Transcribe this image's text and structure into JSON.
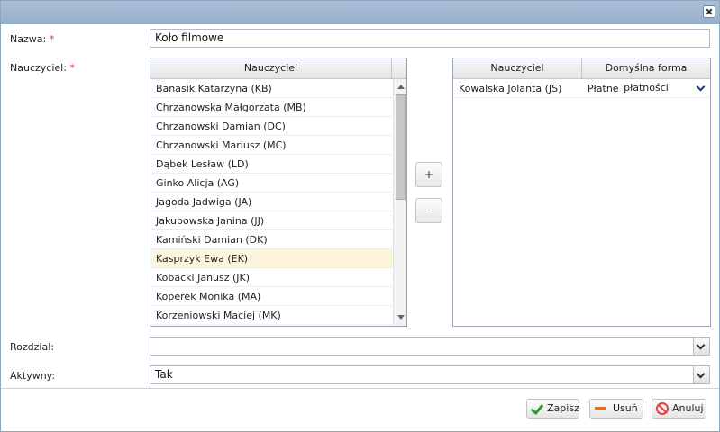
{
  "window": {
    "close_icon": "close-icon"
  },
  "form": {
    "nazwa": {
      "label": "Nazwa:",
      "required": "*",
      "value": "Koło filmowe"
    },
    "nauczyciel": {
      "label": "Nauczyciel:",
      "required": "*"
    },
    "rozdzial": {
      "label": "Rozdział:",
      "value": ""
    },
    "aktywny": {
      "label": "Aktywny:",
      "value": "Tak"
    }
  },
  "available_grid": {
    "header": "Nauczyciel",
    "rows": [
      "Banasik Katarzyna (KB)",
      "Chrzanowska Małgorzata (MB)",
      "Chrzanowski Damian (DC)",
      "Chrzanowski Mariusz (MC)",
      "Dąbek Lesław (LD)",
      "Ginko Alicja (AG)",
      "Jagoda Jadwiga (JA)",
      "Jakubowska Janina (JJ)",
      "Kamiński Damian (DK)",
      "Kasprzyk Ewa (EK)",
      "Kobacki Janusz (JK)",
      "Koperek Monika (MA)",
      "Korzeniowski Maciej (MK)"
    ],
    "highlighted_index": 9
  },
  "move_buttons": {
    "add": "+",
    "remove": "-"
  },
  "selected_grid": {
    "headers": [
      "Nauczyciel",
      "Domyślna forma płatności"
    ],
    "rows": [
      {
        "teacher": "Kowalska Jolanta (JS)",
        "payment": "Płatne"
      }
    ]
  },
  "footer": {
    "save": "Zapisz",
    "delete": "Usuń",
    "cancel": "Anuluj"
  },
  "colors": {
    "titlebar": "#a9bfd6",
    "required": "#d33333",
    "highlight_row": "#fdf5dc"
  }
}
